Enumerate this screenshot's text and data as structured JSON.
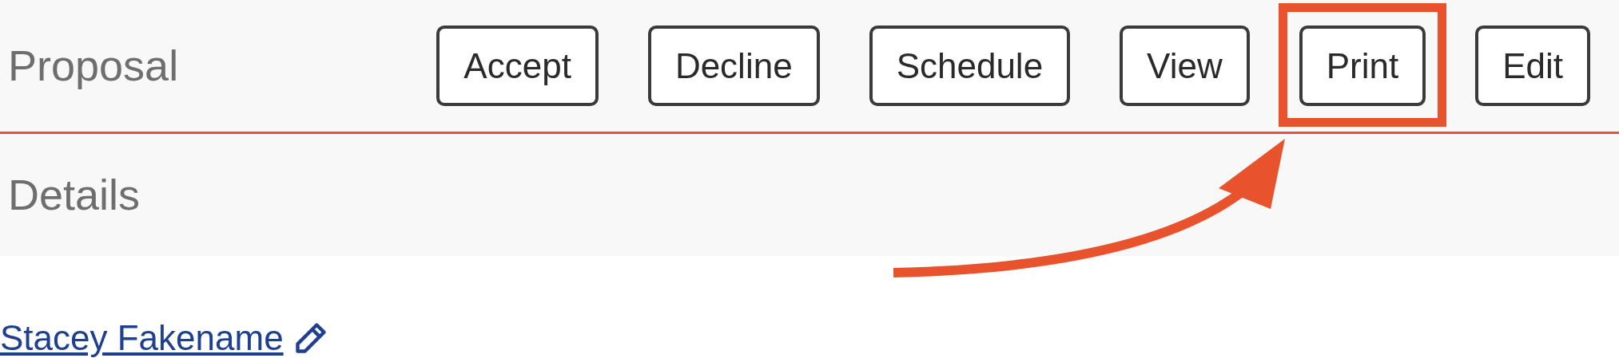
{
  "header": {
    "title": "Proposal",
    "buttons": [
      {
        "label": "Accept",
        "highlighted": false
      },
      {
        "label": "Decline",
        "highlighted": false
      },
      {
        "label": "Schedule",
        "highlighted": false
      },
      {
        "label": "View",
        "highlighted": false
      },
      {
        "label": "Print",
        "highlighted": true
      },
      {
        "label": "Edit",
        "highlighted": false
      }
    ]
  },
  "section": {
    "title": "Details"
  },
  "contact": {
    "name": "Stacey Fakename"
  }
}
